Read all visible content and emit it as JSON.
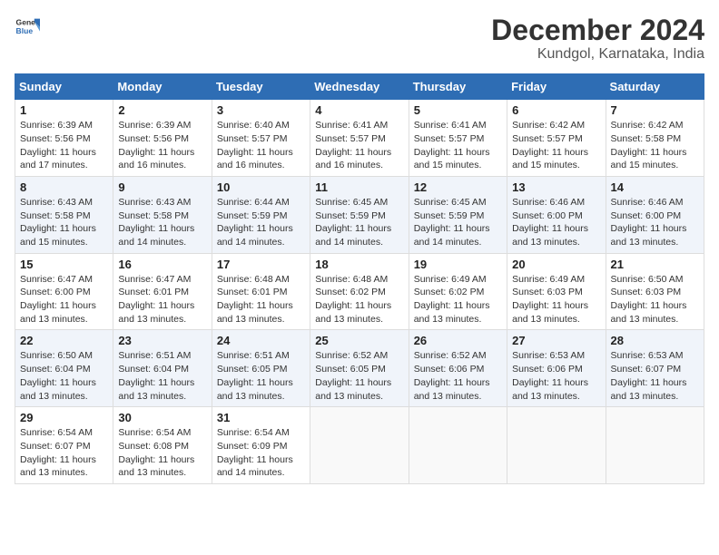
{
  "header": {
    "logo_line1": "General",
    "logo_line2": "Blue",
    "title": "December 2024",
    "subtitle": "Kundgol, Karnataka, India"
  },
  "weekdays": [
    "Sunday",
    "Monday",
    "Tuesday",
    "Wednesday",
    "Thursday",
    "Friday",
    "Saturday"
  ],
  "weeks": [
    [
      {
        "day": "1",
        "info": "Sunrise: 6:39 AM\nSunset: 5:56 PM\nDaylight: 11 hours\nand 17 minutes."
      },
      {
        "day": "2",
        "info": "Sunrise: 6:39 AM\nSunset: 5:56 PM\nDaylight: 11 hours\nand 16 minutes."
      },
      {
        "day": "3",
        "info": "Sunrise: 6:40 AM\nSunset: 5:57 PM\nDaylight: 11 hours\nand 16 minutes."
      },
      {
        "day": "4",
        "info": "Sunrise: 6:41 AM\nSunset: 5:57 PM\nDaylight: 11 hours\nand 16 minutes."
      },
      {
        "day": "5",
        "info": "Sunrise: 6:41 AM\nSunset: 5:57 PM\nDaylight: 11 hours\nand 15 minutes."
      },
      {
        "day": "6",
        "info": "Sunrise: 6:42 AM\nSunset: 5:57 PM\nDaylight: 11 hours\nand 15 minutes."
      },
      {
        "day": "7",
        "info": "Sunrise: 6:42 AM\nSunset: 5:58 PM\nDaylight: 11 hours\nand 15 minutes."
      }
    ],
    [
      {
        "day": "8",
        "info": "Sunrise: 6:43 AM\nSunset: 5:58 PM\nDaylight: 11 hours\nand 15 minutes."
      },
      {
        "day": "9",
        "info": "Sunrise: 6:43 AM\nSunset: 5:58 PM\nDaylight: 11 hours\nand 14 minutes."
      },
      {
        "day": "10",
        "info": "Sunrise: 6:44 AM\nSunset: 5:59 PM\nDaylight: 11 hours\nand 14 minutes."
      },
      {
        "day": "11",
        "info": "Sunrise: 6:45 AM\nSunset: 5:59 PM\nDaylight: 11 hours\nand 14 minutes."
      },
      {
        "day": "12",
        "info": "Sunrise: 6:45 AM\nSunset: 5:59 PM\nDaylight: 11 hours\nand 14 minutes."
      },
      {
        "day": "13",
        "info": "Sunrise: 6:46 AM\nSunset: 6:00 PM\nDaylight: 11 hours\nand 13 minutes."
      },
      {
        "day": "14",
        "info": "Sunrise: 6:46 AM\nSunset: 6:00 PM\nDaylight: 11 hours\nand 13 minutes."
      }
    ],
    [
      {
        "day": "15",
        "info": "Sunrise: 6:47 AM\nSunset: 6:00 PM\nDaylight: 11 hours\nand 13 minutes."
      },
      {
        "day": "16",
        "info": "Sunrise: 6:47 AM\nSunset: 6:01 PM\nDaylight: 11 hours\nand 13 minutes."
      },
      {
        "day": "17",
        "info": "Sunrise: 6:48 AM\nSunset: 6:01 PM\nDaylight: 11 hours\nand 13 minutes."
      },
      {
        "day": "18",
        "info": "Sunrise: 6:48 AM\nSunset: 6:02 PM\nDaylight: 11 hours\nand 13 minutes."
      },
      {
        "day": "19",
        "info": "Sunrise: 6:49 AM\nSunset: 6:02 PM\nDaylight: 11 hours\nand 13 minutes."
      },
      {
        "day": "20",
        "info": "Sunrise: 6:49 AM\nSunset: 6:03 PM\nDaylight: 11 hours\nand 13 minutes."
      },
      {
        "day": "21",
        "info": "Sunrise: 6:50 AM\nSunset: 6:03 PM\nDaylight: 11 hours\nand 13 minutes."
      }
    ],
    [
      {
        "day": "22",
        "info": "Sunrise: 6:50 AM\nSunset: 6:04 PM\nDaylight: 11 hours\nand 13 minutes."
      },
      {
        "day": "23",
        "info": "Sunrise: 6:51 AM\nSunset: 6:04 PM\nDaylight: 11 hours\nand 13 minutes."
      },
      {
        "day": "24",
        "info": "Sunrise: 6:51 AM\nSunset: 6:05 PM\nDaylight: 11 hours\nand 13 minutes."
      },
      {
        "day": "25",
        "info": "Sunrise: 6:52 AM\nSunset: 6:05 PM\nDaylight: 11 hours\nand 13 minutes."
      },
      {
        "day": "26",
        "info": "Sunrise: 6:52 AM\nSunset: 6:06 PM\nDaylight: 11 hours\nand 13 minutes."
      },
      {
        "day": "27",
        "info": "Sunrise: 6:53 AM\nSunset: 6:06 PM\nDaylight: 11 hours\nand 13 minutes."
      },
      {
        "day": "28",
        "info": "Sunrise: 6:53 AM\nSunset: 6:07 PM\nDaylight: 11 hours\nand 13 minutes."
      }
    ],
    [
      {
        "day": "29",
        "info": "Sunrise: 6:54 AM\nSunset: 6:07 PM\nDaylight: 11 hours\nand 13 minutes."
      },
      {
        "day": "30",
        "info": "Sunrise: 6:54 AM\nSunset: 6:08 PM\nDaylight: 11 hours\nand 13 minutes."
      },
      {
        "day": "31",
        "info": "Sunrise: 6:54 AM\nSunset: 6:09 PM\nDaylight: 11 hours\nand 14 minutes."
      },
      {
        "day": "",
        "info": ""
      },
      {
        "day": "",
        "info": ""
      },
      {
        "day": "",
        "info": ""
      },
      {
        "day": "",
        "info": ""
      }
    ]
  ]
}
